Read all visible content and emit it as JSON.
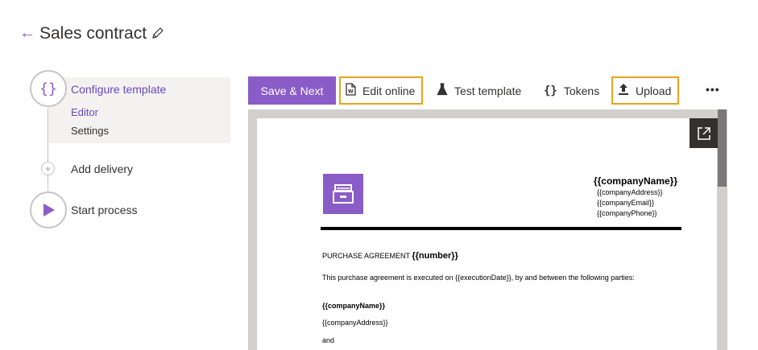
{
  "header": {
    "title": "Sales contract"
  },
  "stepper": {
    "configure": {
      "label": "Configure template",
      "sub_items": [
        "Editor",
        "Settings"
      ]
    },
    "delivery": {
      "label": "Add delivery"
    },
    "start": {
      "label": "Start process"
    }
  },
  "toolbar": {
    "save_next": "Save & Next",
    "edit_online": "Edit online",
    "test_template": "Test template",
    "tokens": "Tokens",
    "upload": "Upload"
  },
  "document": {
    "company_name": "{{companyName}}",
    "company_address": "{{companyAddress}}",
    "company_email": "{{companyEmail}}",
    "company_phone": "{{companyPhone}}",
    "agreement_heading": "PURCHASE AGREEMENT",
    "agreement_number": "{{number}}",
    "intro_text": "This purchase agreement is executed on {{executionDate}}, by and between the following parties:",
    "party_name": "{{companyName}}",
    "party_address": "{{companyAddress}}",
    "and_text": "and"
  },
  "colors": {
    "accent": "#8a5cc7",
    "highlight_outline": "#e8a31f"
  }
}
